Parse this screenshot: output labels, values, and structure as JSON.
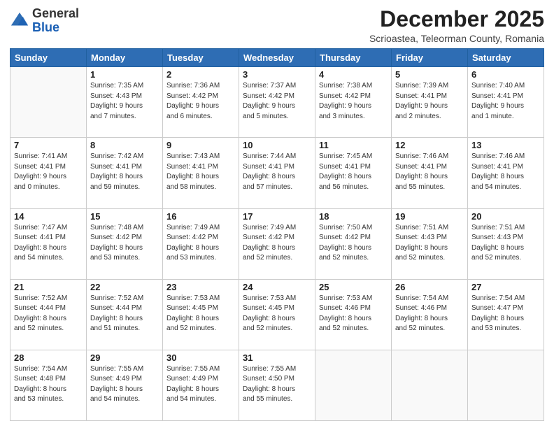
{
  "header": {
    "logo_general": "General",
    "logo_blue": "Blue",
    "month": "December 2025",
    "location": "Scrioastea, Teleorman County, Romania"
  },
  "weekdays": [
    "Sunday",
    "Monday",
    "Tuesday",
    "Wednesday",
    "Thursday",
    "Friday",
    "Saturday"
  ],
  "weeks": [
    [
      {
        "day": "",
        "info": ""
      },
      {
        "day": "1",
        "info": "Sunrise: 7:35 AM\nSunset: 4:43 PM\nDaylight: 9 hours\nand 7 minutes."
      },
      {
        "day": "2",
        "info": "Sunrise: 7:36 AM\nSunset: 4:42 PM\nDaylight: 9 hours\nand 6 minutes."
      },
      {
        "day": "3",
        "info": "Sunrise: 7:37 AM\nSunset: 4:42 PM\nDaylight: 9 hours\nand 5 minutes."
      },
      {
        "day": "4",
        "info": "Sunrise: 7:38 AM\nSunset: 4:42 PM\nDaylight: 9 hours\nand 3 minutes."
      },
      {
        "day": "5",
        "info": "Sunrise: 7:39 AM\nSunset: 4:41 PM\nDaylight: 9 hours\nand 2 minutes."
      },
      {
        "day": "6",
        "info": "Sunrise: 7:40 AM\nSunset: 4:41 PM\nDaylight: 9 hours\nand 1 minute."
      }
    ],
    [
      {
        "day": "7",
        "info": "Sunrise: 7:41 AM\nSunset: 4:41 PM\nDaylight: 9 hours\nand 0 minutes."
      },
      {
        "day": "8",
        "info": "Sunrise: 7:42 AM\nSunset: 4:41 PM\nDaylight: 8 hours\nand 59 minutes."
      },
      {
        "day": "9",
        "info": "Sunrise: 7:43 AM\nSunset: 4:41 PM\nDaylight: 8 hours\nand 58 minutes."
      },
      {
        "day": "10",
        "info": "Sunrise: 7:44 AM\nSunset: 4:41 PM\nDaylight: 8 hours\nand 57 minutes."
      },
      {
        "day": "11",
        "info": "Sunrise: 7:45 AM\nSunset: 4:41 PM\nDaylight: 8 hours\nand 56 minutes."
      },
      {
        "day": "12",
        "info": "Sunrise: 7:46 AM\nSunset: 4:41 PM\nDaylight: 8 hours\nand 55 minutes."
      },
      {
        "day": "13",
        "info": "Sunrise: 7:46 AM\nSunset: 4:41 PM\nDaylight: 8 hours\nand 54 minutes."
      }
    ],
    [
      {
        "day": "14",
        "info": "Sunrise: 7:47 AM\nSunset: 4:41 PM\nDaylight: 8 hours\nand 54 minutes."
      },
      {
        "day": "15",
        "info": "Sunrise: 7:48 AM\nSunset: 4:42 PM\nDaylight: 8 hours\nand 53 minutes."
      },
      {
        "day": "16",
        "info": "Sunrise: 7:49 AM\nSunset: 4:42 PM\nDaylight: 8 hours\nand 53 minutes."
      },
      {
        "day": "17",
        "info": "Sunrise: 7:49 AM\nSunset: 4:42 PM\nDaylight: 8 hours\nand 52 minutes."
      },
      {
        "day": "18",
        "info": "Sunrise: 7:50 AM\nSunset: 4:42 PM\nDaylight: 8 hours\nand 52 minutes."
      },
      {
        "day": "19",
        "info": "Sunrise: 7:51 AM\nSunset: 4:43 PM\nDaylight: 8 hours\nand 52 minutes."
      },
      {
        "day": "20",
        "info": "Sunrise: 7:51 AM\nSunset: 4:43 PM\nDaylight: 8 hours\nand 52 minutes."
      }
    ],
    [
      {
        "day": "21",
        "info": "Sunrise: 7:52 AM\nSunset: 4:44 PM\nDaylight: 8 hours\nand 52 minutes."
      },
      {
        "day": "22",
        "info": "Sunrise: 7:52 AM\nSunset: 4:44 PM\nDaylight: 8 hours\nand 51 minutes."
      },
      {
        "day": "23",
        "info": "Sunrise: 7:53 AM\nSunset: 4:45 PM\nDaylight: 8 hours\nand 52 minutes."
      },
      {
        "day": "24",
        "info": "Sunrise: 7:53 AM\nSunset: 4:45 PM\nDaylight: 8 hours\nand 52 minutes."
      },
      {
        "day": "25",
        "info": "Sunrise: 7:53 AM\nSunset: 4:46 PM\nDaylight: 8 hours\nand 52 minutes."
      },
      {
        "day": "26",
        "info": "Sunrise: 7:54 AM\nSunset: 4:46 PM\nDaylight: 8 hours\nand 52 minutes."
      },
      {
        "day": "27",
        "info": "Sunrise: 7:54 AM\nSunset: 4:47 PM\nDaylight: 8 hours\nand 53 minutes."
      }
    ],
    [
      {
        "day": "28",
        "info": "Sunrise: 7:54 AM\nSunset: 4:48 PM\nDaylight: 8 hours\nand 53 minutes."
      },
      {
        "day": "29",
        "info": "Sunrise: 7:55 AM\nSunset: 4:49 PM\nDaylight: 8 hours\nand 54 minutes."
      },
      {
        "day": "30",
        "info": "Sunrise: 7:55 AM\nSunset: 4:49 PM\nDaylight: 8 hours\nand 54 minutes."
      },
      {
        "day": "31",
        "info": "Sunrise: 7:55 AM\nSunset: 4:50 PM\nDaylight: 8 hours\nand 55 minutes."
      },
      {
        "day": "",
        "info": ""
      },
      {
        "day": "",
        "info": ""
      },
      {
        "day": "",
        "info": ""
      }
    ]
  ]
}
